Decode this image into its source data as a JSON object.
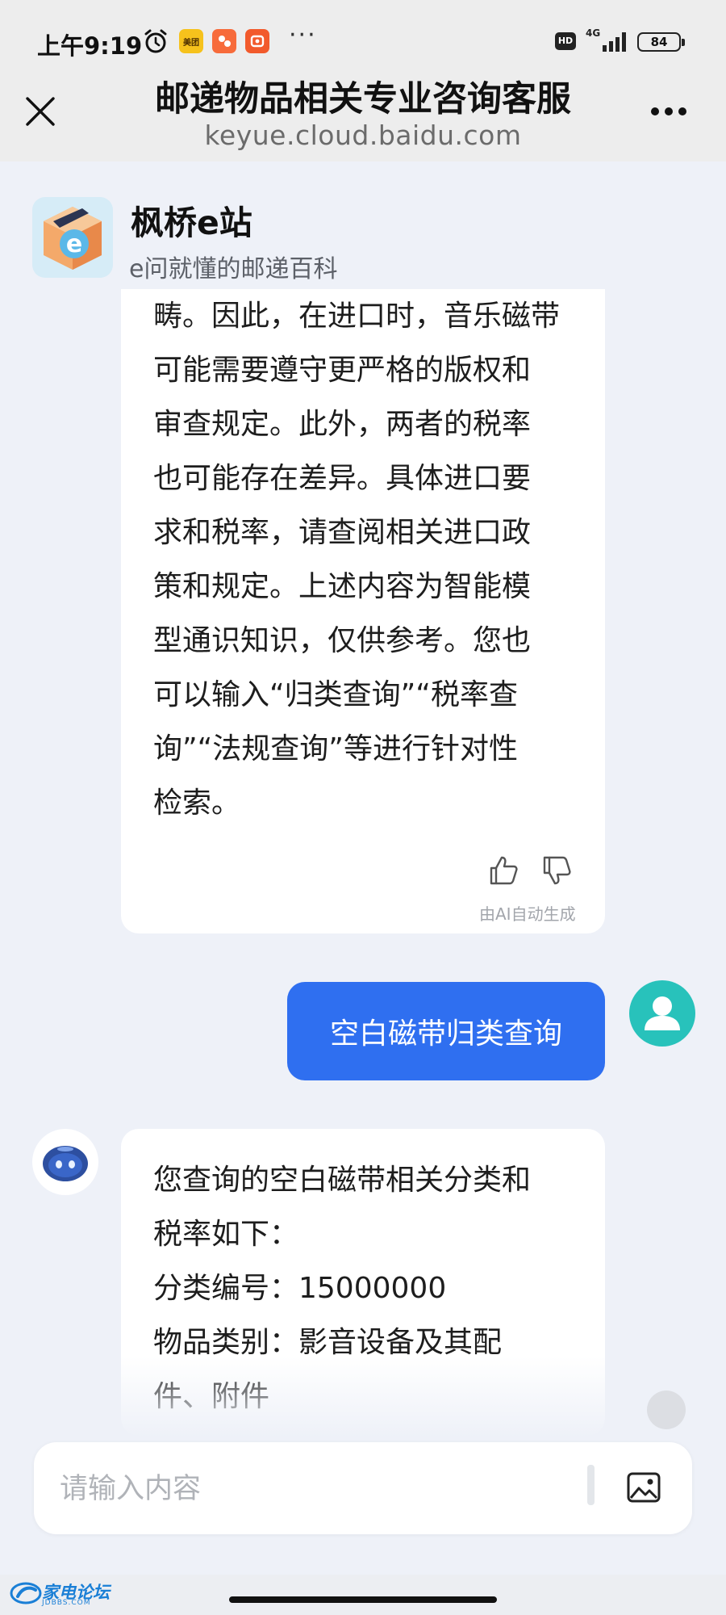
{
  "status_bar": {
    "time": "上午9:19",
    "app_icons": [
      "meituan-app-icon",
      "app-icon-orange",
      "app-icon-red"
    ],
    "more": "···",
    "hd": "HD",
    "network": "4G",
    "battery": "84"
  },
  "title_bar": {
    "title": "邮递物品相关专业咨询客服",
    "url": "keyue.cloud.baidu.com"
  },
  "header": {
    "brand_name": "枫桥e站",
    "tagline": "e问就懂的邮递百科"
  },
  "conversation": {
    "bot_message_1": "畴。因此，在进口时，音乐磁带\n可能需要遵守更严格的版权和\n审查规定。此外，两者的税率\n也可能存在差异。具体进口要\n求和税率，请查阅相关进口政\n策和规定。上述内容为智能模\n型通识知识，仅供参考。您也\n可以输入“归类查询”“税率查\n询”“法规查询”等进行针对性\n检索。",
    "ai_note": "由AI自动生成",
    "user_message": "空白磁带归类查询",
    "bot_message_2": "您查询的空白磁带相关分类和\n税率如下：\n分类编号：15000000\n物品类别：影音设备及其配\n件、附件"
  },
  "input": {
    "placeholder": "请输入内容"
  },
  "footer": {
    "logo_text": "家电论坛",
    "logo_sub": "JDBBS.COM"
  },
  "colors": {
    "accent": "#2f6ff0",
    "user_avatar": "#28c2bb",
    "background": "#eef1f8"
  }
}
